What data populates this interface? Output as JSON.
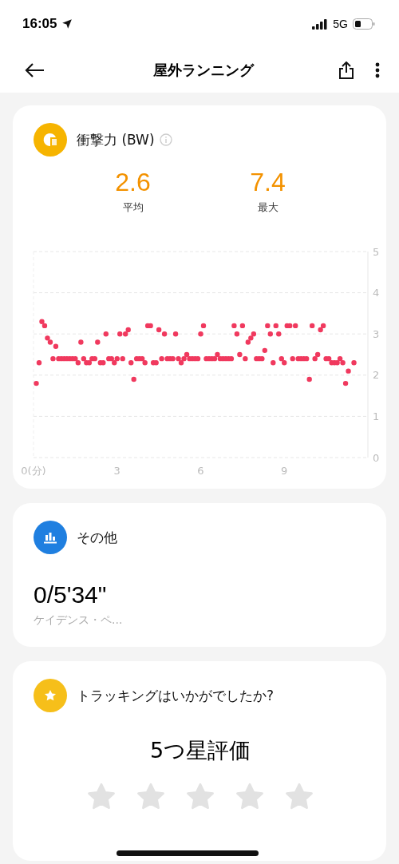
{
  "status_bar": {
    "time": "16:05",
    "network": "5G"
  },
  "header": {
    "title": "屋外ランニング"
  },
  "impact_card": {
    "title": "衝撃力 (BW)",
    "stats": [
      {
        "value": "2.6",
        "label": "平均"
      },
      {
        "value": "7.4",
        "label": "最大"
      }
    ],
    "chart_data": {
      "type": "scatter",
      "grid": true,
      "xlim": [
        0,
        12
      ],
      "ylim": [
        0,
        5
      ],
      "xticks": [
        {
          "value": 0,
          "label": "0(分)"
        },
        3,
        6,
        9
      ],
      "yticks": [
        0,
        1,
        2,
        3,
        4,
        5
      ],
      "x": [
        0.1,
        0.2,
        0.3,
        0.4,
        0.5,
        0.6,
        0.7,
        0.8,
        0.9,
        1.0,
        1.1,
        1.2,
        1.3,
        1.4,
        1.5,
        1.6,
        1.7,
        1.8,
        1.9,
        2.0,
        2.1,
        2.2,
        2.3,
        2.4,
        2.5,
        2.6,
        2.7,
        2.8,
        2.9,
        3.0,
        3.1,
        3.2,
        3.3,
        3.4,
        3.5,
        3.6,
        3.7,
        3.8,
        3.9,
        4.0,
        4.1,
        4.2,
        4.3,
        4.4,
        4.5,
        4.6,
        4.7,
        4.8,
        4.9,
        5.0,
        5.1,
        5.2,
        5.3,
        5.4,
        5.5,
        5.6,
        5.7,
        5.8,
        5.9,
        6.0,
        6.1,
        6.2,
        6.3,
        6.4,
        6.5,
        6.6,
        6.7,
        6.8,
        6.9,
        7.0,
        7.1,
        7.2,
        7.3,
        7.4,
        7.5,
        7.6,
        7.7,
        7.8,
        7.9,
        8.0,
        8.1,
        8.2,
        8.3,
        8.4,
        8.5,
        8.6,
        8.7,
        8.8,
        8.9,
        9.0,
        9.1,
        9.2,
        9.3,
        9.4,
        9.5,
        9.6,
        9.7,
        9.8,
        9.9,
        10.0,
        10.1,
        10.2,
        10.3,
        10.4,
        10.5,
        10.6,
        10.7,
        10.8,
        10.9,
        11.0,
        11.1,
        11.2,
        11.3,
        11.5
      ],
      "series": [
        {
          "color": "#f0395e",
          "values": [
            1.8,
            2.3,
            3.3,
            3.2,
            2.9,
            2.8,
            2.4,
            2.7,
            2.4,
            2.4,
            2.4,
            2.4,
            2.4,
            2.4,
            2.4,
            2.3,
            2.8,
            2.4,
            2.3,
            2.3,
            2.4,
            2.4,
            2.8,
            2.3,
            2.3,
            3.0,
            2.4,
            2.4,
            2.3,
            2.4,
            3.0,
            2.4,
            3.0,
            3.1,
            2.3,
            1.9,
            2.4,
            2.4,
            2.4,
            2.3,
            3.2,
            3.2,
            2.3,
            2.3,
            3.1,
            2.4,
            3.0,
            2.4,
            2.4,
            2.4,
            3.0,
            2.4,
            2.3,
            2.4,
            2.5,
            2.4,
            2.4,
            2.4,
            2.4,
            3.0,
            3.2,
            2.4,
            2.4,
            2.4,
            2.4,
            2.5,
            2.4,
            2.4,
            2.4,
            2.4,
            2.4,
            3.2,
            3.0,
            2.5,
            3.2,
            2.4,
            2.8,
            2.9,
            3.0,
            2.4,
            2.4,
            2.4,
            2.6,
            3.2,
            3.0,
            2.3,
            3.2,
            3.0,
            2.4,
            2.3,
            3.2,
            3.2,
            2.4,
            3.2,
            2.4,
            2.4,
            2.4,
            2.4,
            1.9,
            3.2,
            2.4,
            2.5,
            3.1,
            3.2,
            2.4,
            2.4,
            2.3,
            2.3,
            2.3,
            2.4,
            2.3,
            1.8,
            2.1,
            2.3
          ]
        }
      ]
    }
  },
  "other_card": {
    "title": "その他",
    "value": "0/5'34\"",
    "label": "ケイデンス・ペ..."
  },
  "rating_card": {
    "title": "トラッキングはいかがでしたか?",
    "heading": "5つ星評価",
    "stars": 0
  }
}
